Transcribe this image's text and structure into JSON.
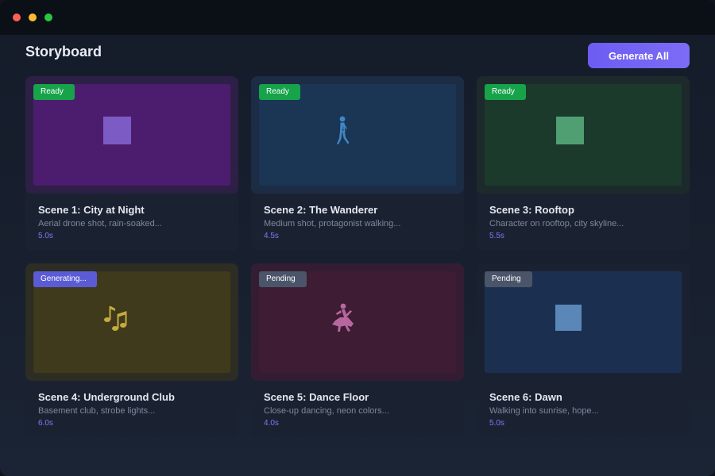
{
  "header": {
    "title": "Storyboard",
    "generate_label": "Generate All"
  },
  "colors": {
    "accent": "#6d5cf2",
    "ready": "#16a34a",
    "generating": "#5b5bd6",
    "pending": "#4b5569"
  },
  "scenes": [
    {
      "title": "Scene 1: City at Night",
      "description": "Aerial drone shot, rain-soaked...",
      "duration": "5.0s",
      "status": "Ready",
      "frame_color": "#2e1f47",
      "thumb_color": "#4c1d6e",
      "art": "square",
      "art_color": "#7c5cc4"
    },
    {
      "title": "Scene 2: The Wanderer",
      "description": "Medium shot, protagonist walking...",
      "duration": "4.5s",
      "status": "Ready",
      "frame_color": "#1c2c44",
      "thumb_color": "#1b3555",
      "art": "walking-person-icon",
      "art_color": "#3f87c4"
    },
    {
      "title": "Scene 3: Rooftop",
      "description": "Character on rooftop, city skyline...",
      "duration": "5.5s",
      "status": "Ready",
      "frame_color": "#1d2a2c",
      "thumb_color": "#1c3a2c",
      "art": "square",
      "art_color": "#4f9f72"
    },
    {
      "title": "Scene 4: Underground Club",
      "description": "Basement club, strobe lights...",
      "duration": "6.0s",
      "status": "Generating...",
      "frame_color": "#2e2d23",
      "thumb_color": "#3f3a1c",
      "art": "music-notes-icon",
      "art_color": "#c7ac3c"
    },
    {
      "title": "Scene 5: Dance Floor",
      "description": "Close-up dancing, neon colors...",
      "duration": "4.0s",
      "status": "Pending",
      "frame_color": "#341d33",
      "thumb_color": "#3d1c34",
      "art": "dancer-icon",
      "art_color": "#b8679e"
    },
    {
      "title": "Scene 6: Dawn",
      "description": "Walking into sunrise, hope...",
      "duration": "5.0s",
      "status": "Pending",
      "frame_color": "#1a2232",
      "thumb_color": "#1b3050",
      "art": "square",
      "art_color": "#5a86b8"
    }
  ]
}
